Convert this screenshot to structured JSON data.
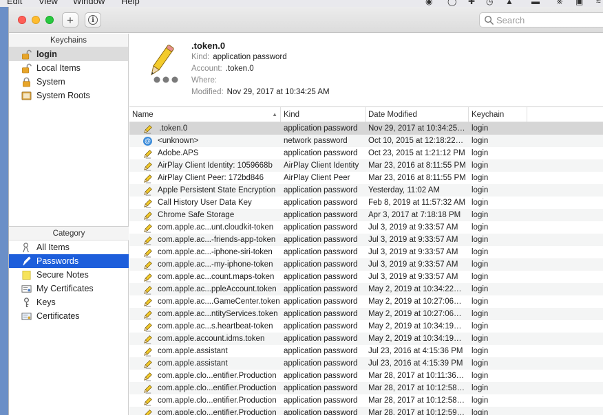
{
  "menubar": {
    "items": [
      "Edit",
      "View",
      "Window",
      "Help"
    ]
  },
  "toolbar": {
    "add_label": "+",
    "search_placeholder": "Search"
  },
  "sidebar": {
    "keychains_header": "Keychains",
    "keychains": [
      {
        "label": "login",
        "icon": "lock-open-icon",
        "selected": true
      },
      {
        "label": "Local Items",
        "icon": "lock-open-icon"
      },
      {
        "label": "System",
        "icon": "lock-icon"
      },
      {
        "label": "System Roots",
        "icon": "cabinet-icon"
      }
    ],
    "category_header": "Category",
    "categories": [
      {
        "label": "All Items",
        "icon": "all-items-icon"
      },
      {
        "label": "Passwords",
        "icon": "pencil-icon",
        "selected": true
      },
      {
        "label": "Secure Notes",
        "icon": "note-icon"
      },
      {
        "label": "My Certificates",
        "icon": "certificate-icon"
      },
      {
        "label": "Keys",
        "icon": "key-icon"
      },
      {
        "label": "Certificates",
        "icon": "certificate-icon"
      }
    ]
  },
  "detail": {
    "title": ".token.0",
    "kind_label": "Kind:",
    "kind": "application password",
    "account_label": "Account:",
    "account": ".token.0",
    "where_label": "Where:",
    "where": "",
    "modified_label": "Modified:",
    "modified": "Nov 29, 2017 at 10:34:25 AM"
  },
  "table": {
    "columns": [
      "Name",
      "Kind",
      "Date Modified",
      "Keychain"
    ],
    "rows": [
      [
        " .token.0",
        "application password",
        "Nov 29, 2017 at 10:34:25…",
        "login"
      ],
      [
        "<unknown>",
        "network password",
        "Oct 10, 2015 at 12:18:22…",
        "login"
      ],
      [
        "Adobe.APS",
        "application password",
        "Oct 23, 2015 at 1:21:12 PM",
        "login"
      ],
      [
        "AirPlay Client Identity: 1059668b",
        "AirPlay Client Identity",
        "Mar 23, 2016 at 8:11:55 PM",
        "login"
      ],
      [
        "AirPlay Client Peer: 172bd846",
        "AirPlay Client Peer",
        "Mar 23, 2016 at 8:11:55 PM",
        "login"
      ],
      [
        "Apple Persistent State Encryption",
        "application password",
        "Yesterday, 11:02 AM",
        "login"
      ],
      [
        "Call History User Data Key",
        "application password",
        "Feb 8, 2019 at 11:57:32 AM",
        "login"
      ],
      [
        "Chrome Safe Storage",
        "application password",
        "Apr 3, 2017 at 7:18:18 PM",
        "login"
      ],
      [
        "com.apple.ac...unt.cloudkit-token",
        "application password",
        "Jul 3, 2019 at 9:33:57 AM",
        "login"
      ],
      [
        "com.apple.ac...-friends-app-token",
        "application password",
        "Jul 3, 2019 at 9:33:57 AM",
        "login"
      ],
      [
        "com.apple.ac...-iphone-siri-token",
        "application password",
        "Jul 3, 2019 at 9:33:57 AM",
        "login"
      ],
      [
        "com.apple.ac...-my-iphone-token",
        "application password",
        "Jul 3, 2019 at 9:33:57 AM",
        "login"
      ],
      [
        "com.apple.ac...count.maps-token",
        "application password",
        "Jul 3, 2019 at 9:33:57 AM",
        "login"
      ],
      [
        "com.apple.ac...ppleAccount.token",
        "application password",
        "May 2, 2019 at 10:34:22…",
        "login"
      ],
      [
        "com.apple.ac....GameCenter.token",
        "application password",
        "May 2, 2019 at 10:27:06…",
        "login"
      ],
      [
        "com.apple.ac...ntityServices.token",
        "application password",
        "May 2, 2019 at 10:27:06…",
        "login"
      ],
      [
        "com.apple.ac...s.heartbeat-token",
        "application password",
        "May 2, 2019 at 10:34:19…",
        "login"
      ],
      [
        "com.apple.account.idms.token",
        "application password",
        "May 2, 2019 at 10:34:19…",
        "login"
      ],
      [
        "com.apple.assistant",
        "application password",
        "Jul 23, 2016 at 4:15:36 PM",
        "login"
      ],
      [
        "com.apple.assistant",
        "application password",
        "Jul 23, 2016 at 4:15:39 PM",
        "login"
      ],
      [
        "com.apple.clo...entifier.Production",
        "application password",
        "Mar 28, 2017 at 10:11:36…",
        "login"
      ],
      [
        "com.apple.clo...entifier.Production",
        "application password",
        "Mar 28, 2017 at 10:12:58…",
        "login"
      ],
      [
        "com.apple.clo...entifier.Production",
        "application password",
        "Mar 28, 2017 at 10:12:58…",
        "login"
      ],
      [
        "com.apple.clo...entifier.Production",
        "application password",
        "Mar 28, 2017 at 10:12:59…",
        "login"
      ]
    ]
  },
  "colors": {
    "selection": "#1d5edb",
    "close": "#fe5f57",
    "minimize": "#febc2e",
    "zoom": "#28c840"
  }
}
